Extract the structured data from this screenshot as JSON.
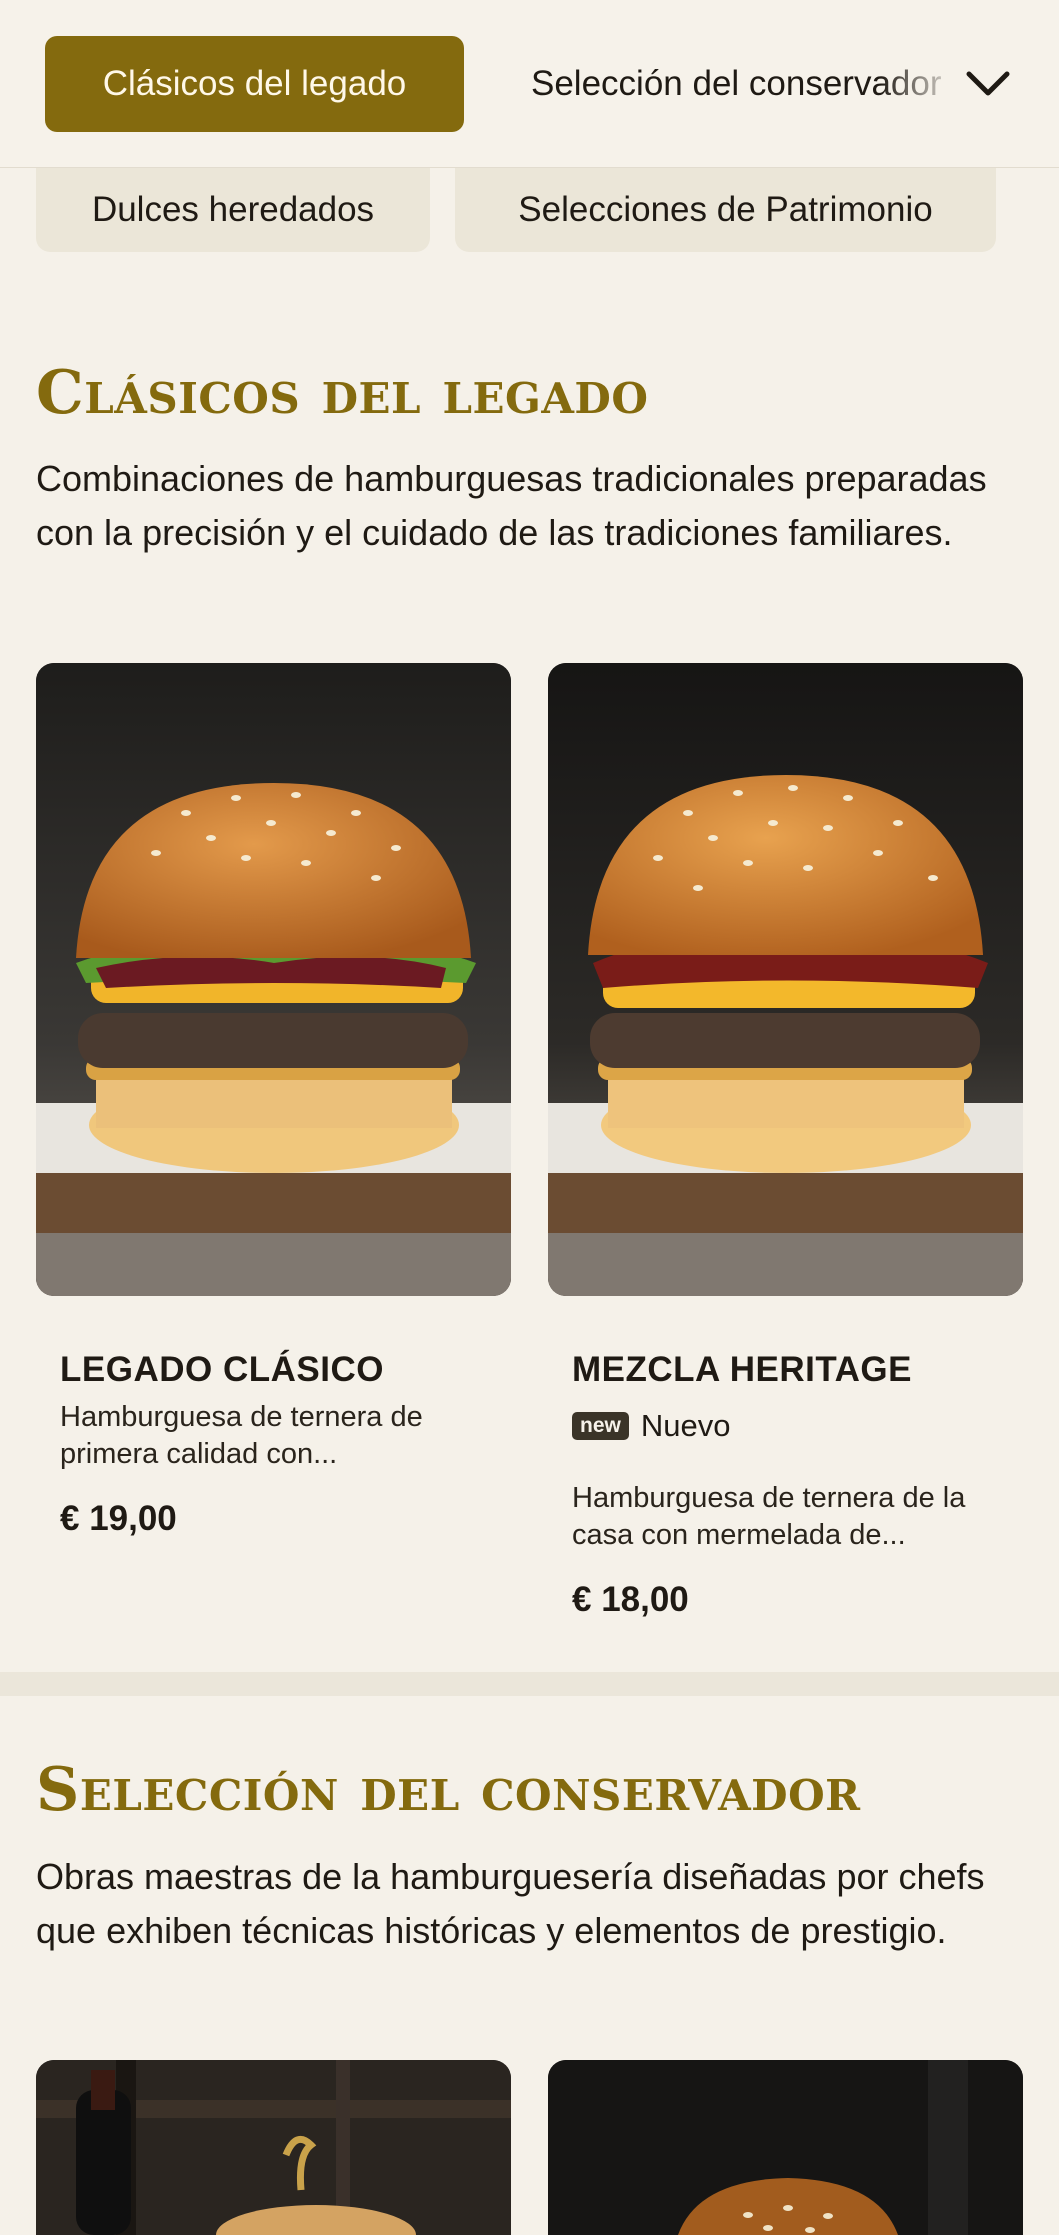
{
  "nav": {
    "active_category": "Clásicos del legado",
    "next_category": "Selección del conservador",
    "sub_categories": [
      "Dulces heredados",
      "Selecciones de Patrimonio"
    ]
  },
  "sections": [
    {
      "title": "Clásicos del legado",
      "description": "Combinaciones de hamburguesas tradicionales preparadas con la precisión y el cuidado de las tradiciones familiares.",
      "products": [
        {
          "name": "LEGADO CLÁSICO",
          "description": "Hamburguesa de ternera de primera calidad con...",
          "price": "€ 19,00"
        },
        {
          "name": "MEZCLA HERITAGE",
          "badge": "new",
          "badge_label": "Nuevo",
          "description": "Hamburguesa de ternera de la casa con mermelada de...",
          "price": "€ 18,00"
        }
      ]
    },
    {
      "title": "Selección del conservador",
      "description": "Obras maestras de la hamburguesería diseñadas por chefs que exhiben técnicas históricas y elementos de prestigio."
    }
  ],
  "colors": {
    "accent": "#846a0e",
    "background": "#f5f1e9",
    "chip": "#ebe6d8",
    "text": "#1f1a14"
  },
  "icons": {
    "dropdown": "chevron-down-icon"
  }
}
